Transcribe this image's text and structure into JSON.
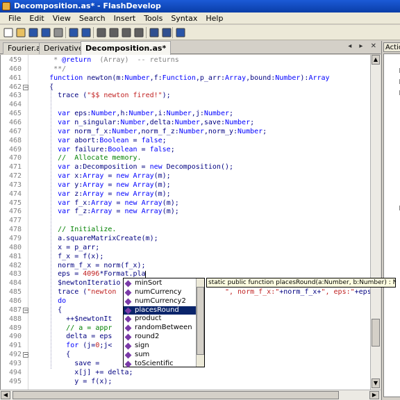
{
  "window": {
    "title": "Decomposition.as* - FlashDevelop"
  },
  "menu": [
    "File",
    "Edit",
    "View",
    "Search",
    "Insert",
    "Tools",
    "Syntax",
    "Help"
  ],
  "toolbar": {
    "icons": [
      "new-file-icon",
      "open-icon",
      "save-icon",
      "save-all-icon",
      "print-icon",
      "undo-icon",
      "redo-icon",
      "cut-icon",
      "copy-icon",
      "paste-icon",
      "delete-icon",
      "find-icon",
      "replace-icon",
      "checkbox-icon"
    ]
  },
  "tabs": [
    {
      "label": "Fourier.as",
      "active": false
    },
    {
      "label": "Derivative.as",
      "active": false
    },
    {
      "label": "Decomposition.as*",
      "active": true
    }
  ],
  "tab_nav": "◂ ▸ ✕",
  "side_panel": {
    "title": "Action"
  },
  "code_lines": [
    {
      "n": "459",
      "html": "    <span class='doc'> * <span class='kw'>@return</span>  (Array)  -- returns</span>"
    },
    {
      "n": "460",
      "html": "    <span class='doc'> **/</span>"
    },
    {
      "n": "461",
      "html": "    <span class='kw'>function</span> newton(m:<span class='kw'>Number</span>,f:<span class='kw'>Function</span>,p_arr:<span class='kw'>Array</span>,bound:<span class='kw'>Number</span>):<span class='kw'>Array</span>"
    },
    {
      "n": "462",
      "html": "    {"
    },
    {
      "n": "463",
      "html": "      trace (<span class='str'>\"$$ newton fired!\"</span>);"
    },
    {
      "n": "464",
      "html": ""
    },
    {
      "n": "465",
      "html": "      <span class='kw'>var</span> eps:<span class='kw'>Number</span>,h:<span class='kw'>Number</span>,i:<span class='kw'>Number</span>,j:<span class='kw'>Number</span>;"
    },
    {
      "n": "466",
      "html": "      <span class='kw'>var</span> n_singular:<span class='kw'>Number</span>,delta:<span class='kw'>Number</span>,save:<span class='kw'>Number</span>;"
    },
    {
      "n": "467",
      "html": "      <span class='kw'>var</span> norm_f_x:<span class='kw'>Number</span>,norm_f_z:<span class='kw'>Number</span>,norm_y:<span class='kw'>Number</span>;"
    },
    {
      "n": "468",
      "html": "      <span class='kw'>var</span> abort:<span class='kw'>Boolean</span> = <span class='kw'>false</span>;"
    },
    {
      "n": "469",
      "html": "      <span class='kw'>var</span> failure:<span class='kw'>Boolean</span> = <span class='kw'>false</span>;"
    },
    {
      "n": "470",
      "html": "      <span class='cm'>//  Allocate memory.</span>"
    },
    {
      "n": "471",
      "html": "      <span class='kw'>var</span> a:Decomposition = <span class='kw'>new</span> Decomposition();"
    },
    {
      "n": "472",
      "html": "      <span class='kw'>var</span> x:<span class='kw'>Array</span> = <span class='kw'>new</span> <span class='kw'>Array</span>(m);"
    },
    {
      "n": "473",
      "html": "      <span class='kw'>var</span> y:<span class='kw'>Array</span> = <span class='kw'>new</span> <span class='kw'>Array</span>(m);"
    },
    {
      "n": "474",
      "html": "      <span class='kw'>var</span> z:<span class='kw'>Array</span> = <span class='kw'>new</span> <span class='kw'>Array</span>(m);"
    },
    {
      "n": "475",
      "html": "      <span class='kw'>var</span> f_x:<span class='kw'>Array</span> = <span class='kw'>new</span> <span class='kw'>Array</span>(m);"
    },
    {
      "n": "476",
      "html": "      <span class='kw'>var</span> f_z:<span class='kw'>Array</span> = <span class='kw'>new</span> <span class='kw'>Array</span>(m);"
    },
    {
      "n": "477",
      "html": ""
    },
    {
      "n": "478",
      "html": "      <span class='cm'>// Initialize.</span>"
    },
    {
      "n": "479",
      "html": "      a.squareMatrixCreate(m);"
    },
    {
      "n": "480",
      "html": "      x = p_arr;"
    },
    {
      "n": "481",
      "html": "      f_x = f(x);"
    },
    {
      "n": "482",
      "html": "      norm_f_x = norm(f_x);"
    },
    {
      "n": "483",
      "html": "      eps = <span class='num'>4096</span>*Format.pla"
    },
    {
      "n": "484",
      "html": "      $newtonIteratio"
    },
    {
      "n": "485",
      "html": "      trace (<span class='str'>\"newton </span>                         <span class='str'>\", norm_f_x:\"</span>+norm_f_x+<span class='str'>\", eps:\"</span>+eps);"
    },
    {
      "n": "486",
      "html": "      <span class='kw'>do</span>"
    },
    {
      "n": "487",
      "html": "      {"
    },
    {
      "n": "488",
      "html": "        ++$newtonIt"
    },
    {
      "n": "489",
      "html": "        <span class='cm'>// a = appr                  z).</span>"
    },
    {
      "n": "490",
      "html": "        delta = eps"
    },
    {
      "n": "491",
      "html": "        <span class='kw'>for</span> (j=<span class='num'>0</span>;j<"
    },
    {
      "n": "492",
      "html": "        {"
    },
    {
      "n": "493",
      "html": "          save = "
    },
    {
      "n": "494",
      "html": "          x[j] += delta;"
    },
    {
      "n": "495",
      "html": "          y = f(x);"
    }
  ],
  "autocomplete": {
    "items": [
      "minSort",
      "numCurrency",
      "numCurrency2",
      "placesRound",
      "product",
      "randomBetween",
      "round2",
      "sign",
      "sum",
      "toScientific"
    ],
    "selected_index": 3
  },
  "tooltip": {
    "text": "static public function placesRound(a:Number, b:Number) : Number"
  }
}
